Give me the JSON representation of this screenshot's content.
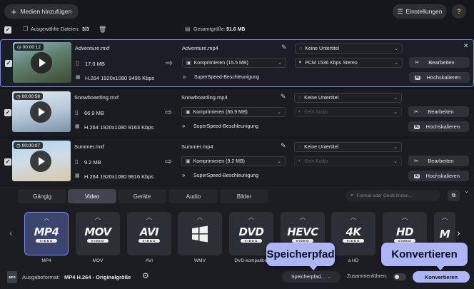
{
  "toolbar": {
    "add_media_label": "Medien hinzufügen",
    "settings_label": "Einstellungen",
    "help_label": "?"
  },
  "selection_bar": {
    "selected_label": "Ausgewählte Dateien:",
    "selected_count": "3/3",
    "total_size_label": "Gesamtgröße:",
    "total_size_value": "91.6 MB"
  },
  "files": [
    {
      "duration": "00:00:12",
      "source_name": "Adventure.mxf",
      "source_size": "17.0 MB",
      "source_codec": "H.264 1920x1080 9495 Kbps",
      "output_name": "Adventure.mp4",
      "compress": "Komprimieren (15.5 MB)",
      "speed": "SuperSpeed-Beschleunigung",
      "subtitle": "Keine Untertitel",
      "audio": "PCM 1536 Kbps Stereo",
      "edit_label": "Bearbeiten",
      "upscale_label": "Hochskalieren"
    },
    {
      "duration": "00:00:58",
      "source_name": "Snowboarding.mxf",
      "source_size": "66.9 MB",
      "source_codec": "H.264 1920x1080 9163 Kbps",
      "output_name": "Snowboarding.mp4",
      "compress": "Komprimieren (66.9 MB)",
      "speed": "SuperSpeed-Beschleunigung",
      "subtitle": "Keine Untertitel",
      "audio": "Kein Audio",
      "edit_label": "Bearbeiten",
      "upscale_label": "Hochskalieren"
    },
    {
      "duration": "00:00:07",
      "source_name": "Summer.mxf",
      "source_size": "9.2 MB",
      "source_codec": "H.264 1920x1080 9816 Kbps",
      "output_name": "Summer.mp4",
      "compress": "Komprimieren (9.2 MB)",
      "speed": "SuperSpeed-Beschleunigung",
      "subtitle": "Keine Untertitel",
      "audio": "Kein Audio",
      "edit_label": "Bearbeiten",
      "upscale_label": "Hochskalieren"
    }
  ],
  "tabs": [
    "Gängig",
    "Video",
    "Geräte",
    "Audio",
    "Bilder"
  ],
  "active_tab": "Video",
  "format_search": {
    "placeholder": "Format oder Gerät finden..."
  },
  "formats": [
    {
      "logo": "MP4",
      "sub": "VIDEO",
      "label": "MP4"
    },
    {
      "logo": "MOV",
      "sub": "VIDEO",
      "label": "MOV"
    },
    {
      "logo": "AVI",
      "sub": "VIDEO",
      "label": "AVI"
    },
    {
      "logo": "",
      "sub": "",
      "label": "WMV"
    },
    {
      "logo": "DVD",
      "sub": "VIDEO",
      "label": "DVD-kompatible"
    },
    {
      "logo": "HEVC",
      "sub": "VIDEO",
      "label": ""
    },
    {
      "logo": "4K",
      "sub": "VIDEO",
      "label": "a HD"
    },
    {
      "logo": "HD",
      "sub": "VIDEO",
      "label": ""
    },
    {
      "logo": "M",
      "sub": "",
      "label": ""
    }
  ],
  "footer": {
    "output_format_label": "Ausgabeformat:",
    "output_format_value": "MP4 H.264 - Originalgröße",
    "save_path_label": "Speicherpfad...",
    "merge_label": "Zusammenführen:",
    "convert_label": "Konvertieren"
  },
  "callouts": {
    "save_path": "Speicherpfad",
    "convert": "Konvertieren"
  },
  "colors": {
    "accent": "#aeb5f4",
    "selection_border": "#7d86d8",
    "background": "#15171c"
  }
}
